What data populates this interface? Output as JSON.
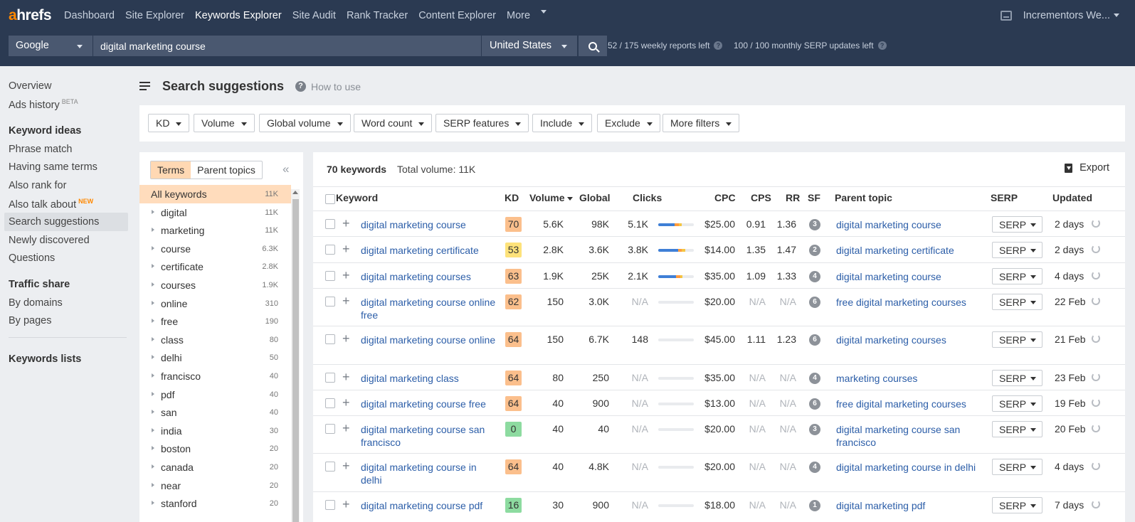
{
  "topnav": {
    "logo_a": "a",
    "logo_rest": "hrefs",
    "links": [
      "Dashboard",
      "Site Explorer",
      "Keywords Explorer",
      "Site Audit",
      "Rank Tracker",
      "Content Explorer",
      "More"
    ],
    "active": "Keywords Explorer",
    "account": "Incrementors We..."
  },
  "search": {
    "engine": "Google",
    "query": "digital marketing course",
    "country": "United States",
    "weekly_quota": "52 / 175 weekly reports left",
    "monthly_quota": "100 / 100 monthly SERP updates left"
  },
  "sidebar": {
    "overview": "Overview",
    "ads_history": "Ads history",
    "ads_badge": "BETA",
    "keyword_ideas_title": "Keyword ideas",
    "phrase_match": "Phrase match",
    "same_terms": "Having same terms",
    "also_rank": "Also rank for",
    "also_talk": "Also talk about",
    "new_badge": "NEW",
    "search_suggestions": "Search suggestions",
    "newly": "Newly discovered",
    "questions": "Questions",
    "traffic_title": "Traffic share",
    "by_domains": "By domains",
    "by_pages": "By pages",
    "lists_title": "Keywords lists"
  },
  "page": {
    "title": "Search suggestions",
    "how_to_use": "How to use",
    "help_glyph": "?"
  },
  "filters": [
    "KD",
    "Volume",
    "Global volume",
    "Word count",
    "SERP features",
    "Include",
    "Exclude",
    "More filters"
  ],
  "terms": {
    "tab_terms": "Terms",
    "tab_parent": "Parent topics",
    "collapse_glyph": "«",
    "items": [
      {
        "label": "All keywords",
        "count": "11K"
      },
      {
        "label": "digital",
        "count": "11K"
      },
      {
        "label": "marketing",
        "count": "11K"
      },
      {
        "label": "course",
        "count": "6.3K"
      },
      {
        "label": "certificate",
        "count": "2.8K"
      },
      {
        "label": "courses",
        "count": "1.9K"
      },
      {
        "label": "online",
        "count": "310"
      },
      {
        "label": "free",
        "count": "190"
      },
      {
        "label": "class",
        "count": "80"
      },
      {
        "label": "delhi",
        "count": "50"
      },
      {
        "label": "francisco",
        "count": "40"
      },
      {
        "label": "pdf",
        "count": "40"
      },
      {
        "label": "san",
        "count": "40"
      },
      {
        "label": "india",
        "count": "30"
      },
      {
        "label": "boston",
        "count": "20"
      },
      {
        "label": "canada",
        "count": "20"
      },
      {
        "label": "near",
        "count": "20"
      },
      {
        "label": "stanford",
        "count": "20"
      }
    ]
  },
  "results": {
    "count": "70 keywords",
    "total": "Total volume: 11K",
    "export": "Export",
    "headers": {
      "keyword": "Keyword",
      "kd": "KD",
      "volume": "Volume",
      "global": "Global",
      "clicks": "Clicks",
      "cpc": "CPC",
      "cps": "CPS",
      "rr": "RR",
      "sf": "SF",
      "parent": "Parent topic",
      "serp": "SERP",
      "updated": "Updated"
    },
    "plus_glyph": "+",
    "serp_label": "SERP",
    "kd_colors": {
      "high": "#fbbf8c",
      "mid": "#fde27a",
      "low": "#8ddba0"
    },
    "rows": [
      {
        "keyword": "digital marketing course",
        "kd": "70",
        "kd_level": "high",
        "volume": "5.6K",
        "global": "98K",
        "clicks": "5.1K",
        "cpc": "$25.00",
        "cps": "0.91",
        "rr": "1.36",
        "sf": "3",
        "parent": "digital marketing course",
        "updated": "2 days",
        "clicks_split": [
          0.45,
          0.12,
          0.08
        ]
      },
      {
        "keyword": "digital marketing certificate",
        "kd": "53",
        "kd_level": "mid",
        "volume": "2.8K",
        "global": "3.6K",
        "clicks": "3.8K",
        "cpc": "$14.00",
        "cps": "1.35",
        "rr": "1.47",
        "sf": "2",
        "parent": "digital marketing certificate",
        "updated": "2 days",
        "clicks_split": [
          0.55,
          0.1,
          0.1
        ]
      },
      {
        "keyword": "digital marketing courses",
        "kd": "63",
        "kd_level": "high",
        "volume": "1.9K",
        "global": "25K",
        "clicks": "2.1K",
        "cpc": "$35.00",
        "cps": "1.09",
        "rr": "1.33",
        "sf": "4",
        "parent": "digital marketing course",
        "updated": "4 days",
        "clicks_split": [
          0.5,
          0.12,
          0.06
        ]
      },
      {
        "keyword": "digital marketing course online free",
        "kd": "62",
        "kd_level": "high",
        "volume": "150",
        "global": "3.0K",
        "clicks": "N/A",
        "cpc": "$20.00",
        "cps": "N/A",
        "rr": "N/A",
        "sf": "6",
        "parent": "free digital marketing courses",
        "updated": "22 Feb",
        "clicks_split": []
      },
      {
        "keyword": "digital marketing course online",
        "kd": "64",
        "kd_level": "high",
        "volume": "150",
        "global": "6.7K",
        "clicks": "148",
        "cpc": "$45.00",
        "cps": "1.11",
        "rr": "1.23",
        "sf": "6",
        "parent": "digital marketing courses",
        "updated": "21 Feb",
        "clicks_split": []
      },
      {
        "keyword": "digital marketing class",
        "kd": "64",
        "kd_level": "high",
        "volume": "80",
        "global": "250",
        "clicks": "N/A",
        "cpc": "$35.00",
        "cps": "N/A",
        "rr": "N/A",
        "sf": "4",
        "parent": "marketing courses",
        "updated": "23 Feb",
        "clicks_split": []
      },
      {
        "keyword": "digital marketing course free",
        "kd": "64",
        "kd_level": "high",
        "volume": "40",
        "global": "900",
        "clicks": "N/A",
        "cpc": "$13.00",
        "cps": "N/A",
        "rr": "N/A",
        "sf": "6",
        "parent": "free digital marketing courses",
        "updated": "19 Feb",
        "clicks_split": []
      },
      {
        "keyword": "digital marketing course san francisco",
        "kd": "0",
        "kd_level": "low",
        "volume": "40",
        "global": "40",
        "clicks": "N/A",
        "cpc": "$20.00",
        "cps": "N/A",
        "rr": "N/A",
        "sf": "3",
        "parent": "digital marketing course san francisco",
        "updated": "20 Feb",
        "clicks_split": []
      },
      {
        "keyword": "digital marketing course in delhi",
        "kd": "64",
        "kd_level": "high",
        "volume": "40",
        "global": "4.8K",
        "clicks": "N/A",
        "cpc": "$20.00",
        "cps": "N/A",
        "rr": "N/A",
        "sf": "4",
        "parent": "digital marketing course in delhi",
        "updated": "4 days",
        "clicks_split": []
      },
      {
        "keyword": "digital marketing course pdf",
        "kd": "16",
        "kd_level": "low",
        "volume": "30",
        "global": "900",
        "clicks": "N/A",
        "cpc": "$18.00",
        "cps": "N/A",
        "rr": "N/A",
        "sf": "1",
        "parent": "digital marketing pdf",
        "updated": "7 days",
        "clicks_split": []
      }
    ]
  }
}
